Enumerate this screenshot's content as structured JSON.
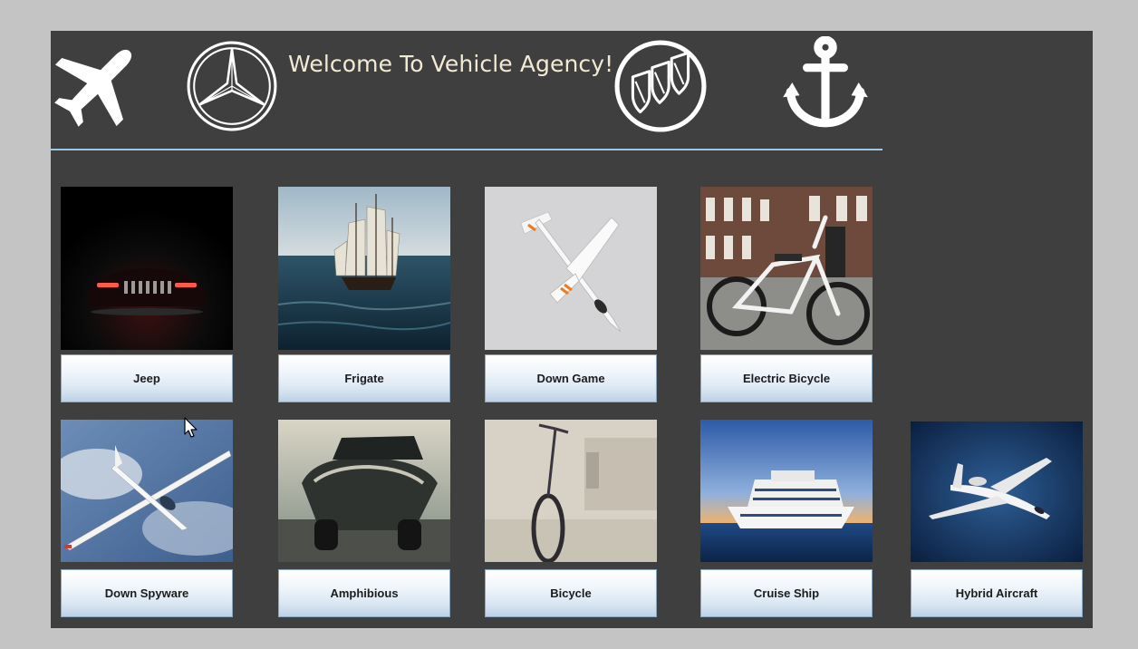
{
  "window": {
    "title": "Welcome To Vehicle Agency!"
  },
  "header_icons": [
    "airplane-icon",
    "mercedes-logo-icon",
    "buick-logo-icon",
    "anchor-icon"
  ],
  "vehicles_row1": [
    {
      "label": "Jeep",
      "image": "jeep-photo"
    },
    {
      "label": "Frigate",
      "image": "frigate-photo"
    },
    {
      "label": "Down Game",
      "image": "glider-toy-photo"
    },
    {
      "label": "Electric Bicycle",
      "image": "electric-bicycle-photo"
    }
  ],
  "vehicles_row2": [
    {
      "label": "Down Spyware",
      "image": "glider-sky-photo"
    },
    {
      "label": "Amphibious",
      "image": "amphibious-boat-photo"
    },
    {
      "label": "Bicycle",
      "image": "bicycle-photo"
    },
    {
      "label": "Cruise Ship",
      "image": "cruise-ship-photo"
    },
    {
      "label": "Hybrid Aircraft",
      "image": "private-jet-photo"
    }
  ],
  "colors": {
    "background": "#c4c4c4",
    "panel": "#3f3f3f",
    "title_text": "#f2ead3",
    "divider": "#9fc7e6",
    "button_gradient_bottom": "#bdd2e6"
  }
}
